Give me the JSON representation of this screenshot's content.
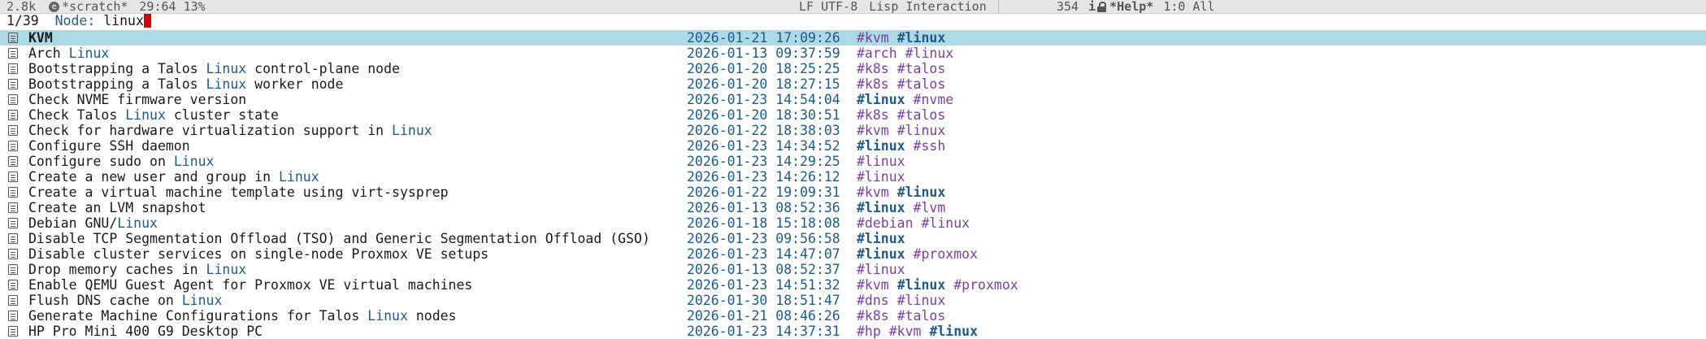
{
  "modeline": {
    "size": "2.8k",
    "buffer": "*scratch*",
    "position": "29:64 13%",
    "encoding": "LF UTF-8",
    "mode": "Lisp Interaction",
    "line_number": "354",
    "help_buffer": "*Help*",
    "help_position": "1:0 All"
  },
  "minibuffer": {
    "count": "1/39",
    "prompt": "Node:",
    "input": "linux"
  },
  "nodes": [
    {
      "title": [
        "KVM"
      ],
      "timestamp": "2026-01-21 17:09:26",
      "tags": [
        [
          "#kvm",
          false
        ],
        [
          "#linux",
          true
        ]
      ]
    },
    {
      "title": [
        "Arch ",
        "Linux"
      ],
      "timestamp": "2026-01-13 09:37:59",
      "tags": [
        [
          "#arch",
          false
        ],
        [
          "#linux",
          false
        ]
      ]
    },
    {
      "title": [
        "Bootstrapping a Talos ",
        "Linux",
        " control-plane node"
      ],
      "timestamp": "2026-01-20 18:25:25",
      "tags": [
        [
          "#k8s",
          false
        ],
        [
          "#talos",
          false
        ]
      ]
    },
    {
      "title": [
        "Bootstrapping a Talos ",
        "Linux",
        " worker node"
      ],
      "timestamp": "2026-01-20 18:27:15",
      "tags": [
        [
          "#k8s",
          false
        ],
        [
          "#talos",
          false
        ]
      ]
    },
    {
      "title": [
        "Check NVME firmware version"
      ],
      "timestamp": "2026-01-23 14:54:04",
      "tags": [
        [
          "#linux",
          true
        ],
        [
          "#nvme",
          false
        ]
      ]
    },
    {
      "title": [
        "Check Talos ",
        "Linux",
        " cluster state"
      ],
      "timestamp": "2026-01-20 18:30:51",
      "tags": [
        [
          "#k8s",
          false
        ],
        [
          "#talos",
          false
        ]
      ]
    },
    {
      "title": [
        "Check for hardware virtualization support in ",
        "Linux"
      ],
      "timestamp": "2026-01-22 18:38:03",
      "tags": [
        [
          "#kvm",
          false
        ],
        [
          "#linux",
          false
        ]
      ]
    },
    {
      "title": [
        "Configure SSH daemon"
      ],
      "timestamp": "2026-01-23 14:34:52",
      "tags": [
        [
          "#linux",
          true
        ],
        [
          "#ssh",
          false
        ]
      ]
    },
    {
      "title": [
        "Configure sudo on ",
        "Linux"
      ],
      "timestamp": "2026-01-23 14:29:25",
      "tags": [
        [
          "#linux",
          false
        ]
      ]
    },
    {
      "title": [
        "Create a new user and group in ",
        "Linux"
      ],
      "timestamp": "2026-01-23 14:26:12",
      "tags": [
        [
          "#linux",
          false
        ]
      ]
    },
    {
      "title": [
        "Create a virtual machine template using virt-sysprep"
      ],
      "timestamp": "2026-01-22 19:09:31",
      "tags": [
        [
          "#kvm",
          false
        ],
        [
          "#linux",
          true
        ]
      ]
    },
    {
      "title": [
        "Create an LVM snapshot"
      ],
      "timestamp": "2026-01-13 08:52:36",
      "tags": [
        [
          "#linux",
          true
        ],
        [
          "#lvm",
          false
        ]
      ]
    },
    {
      "title": [
        "Debian GNU/",
        "Linux"
      ],
      "timestamp": "2026-01-18 15:18:08",
      "tags": [
        [
          "#debian",
          false
        ],
        [
          "#linux",
          false
        ]
      ]
    },
    {
      "title": [
        "Disable TCP Segmentation Offload (TSO) and Generic Segmentation Offload (GSO)"
      ],
      "timestamp": "2026-01-23 09:56:58",
      "tags": [
        [
          "#linux",
          true
        ]
      ]
    },
    {
      "title": [
        "Disable cluster services on single-node Proxmox VE setups"
      ],
      "timestamp": "2026-01-23 14:47:07",
      "tags": [
        [
          "#linux",
          true
        ],
        [
          "#proxmox",
          false
        ]
      ]
    },
    {
      "title": [
        "Drop memory caches in ",
        "Linux"
      ],
      "timestamp": "2026-01-13 08:52:37",
      "tags": [
        [
          "#linux",
          false
        ]
      ]
    },
    {
      "title": [
        "Enable QEMU Guest Agent for Proxmox VE virtual machines"
      ],
      "timestamp": "2026-01-23 14:51:32",
      "tags": [
        [
          "#kvm",
          false
        ],
        [
          "#linux",
          true
        ],
        [
          "#proxmox",
          false
        ]
      ]
    },
    {
      "title": [
        "Flush DNS cache on ",
        "Linux"
      ],
      "timestamp": "2026-01-30 18:51:47",
      "tags": [
        [
          "#dns",
          false
        ],
        [
          "#linux",
          false
        ]
      ]
    },
    {
      "title": [
        "Generate Machine Configurations for Talos ",
        "Linux",
        " nodes"
      ],
      "timestamp": "2026-01-21 08:46:26",
      "tags": [
        [
          "#k8s",
          false
        ],
        [
          "#talos",
          false
        ]
      ]
    },
    {
      "title": [
        "HP Pro Mini 400 G9 Desktop PC"
      ],
      "timestamp": "2026-01-23 14:37:31",
      "tags": [
        [
          "#hp",
          false
        ],
        [
          "#kvm",
          false
        ],
        [
          "#linux",
          true
        ]
      ]
    }
  ]
}
